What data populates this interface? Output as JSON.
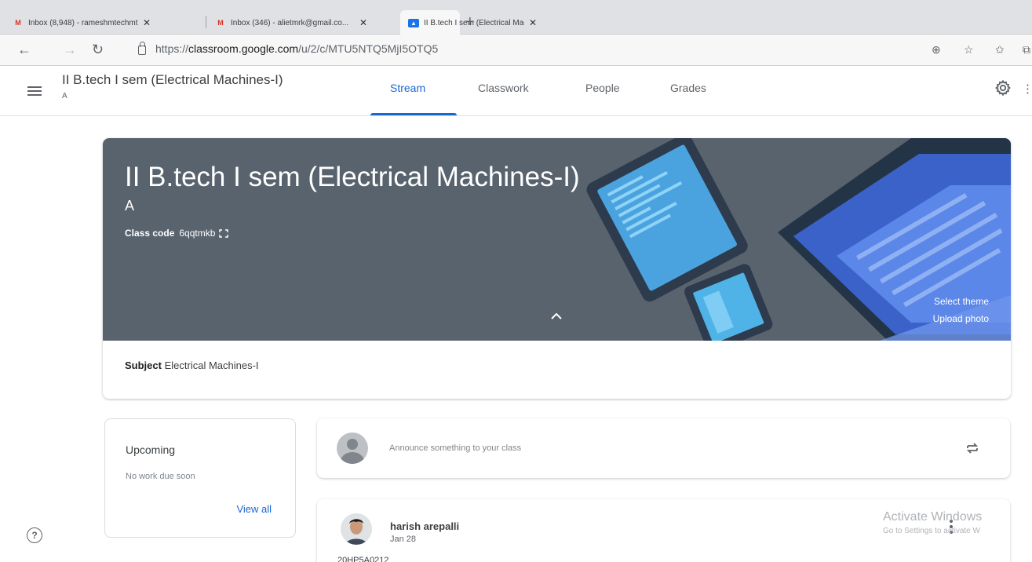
{
  "browser": {
    "tabs": [
      {
        "favicon": "gmail-icon",
        "title": "Inbox (8,948) - rameshmtechmt...",
        "close": "✕"
      },
      {
        "favicon": "gmail-icon",
        "title": "Inbox (346) - alietmrk@gmail.co...",
        "close": "✕"
      },
      {
        "favicon": "classroom-icon",
        "title": "II B.tech I sem (Electrical Machin...",
        "close": "✕"
      }
    ],
    "new_tab": "+",
    "url_prefix": "https://",
    "url_host": "classroom.google.com",
    "url_path": "/u/2/c/MTU5NTQ5MjI5OTQ5"
  },
  "header": {
    "title": "II B.tech I sem (Electrical Machines-I)",
    "section": "A",
    "tabs": [
      "Stream",
      "Classwork",
      "People",
      "Grades"
    ],
    "active_tab": "Stream"
  },
  "banner": {
    "title": "II B.tech I sem (Electrical Machines-I)",
    "section": "A",
    "class_code_label": "Class code",
    "class_code": "6qqtmkb",
    "select_theme": "Select theme",
    "upload_photo": "Upload photo",
    "background_color": "#59636e"
  },
  "subject": {
    "label": "Subject",
    "value": "Electrical Machines-I"
  },
  "upcoming": {
    "title": "Upcoming",
    "empty_text": "No work due soon",
    "view_all": "View all"
  },
  "announce": {
    "placeholder": "Announce something to your class"
  },
  "post": {
    "author": "harish arepalli",
    "date": "Jan 28",
    "body": "20HP5A0212"
  },
  "watermark": {
    "title": "Activate Windows",
    "subtitle": "Go to Settings to activate W"
  },
  "colors": {
    "accent": "#1967d2"
  }
}
